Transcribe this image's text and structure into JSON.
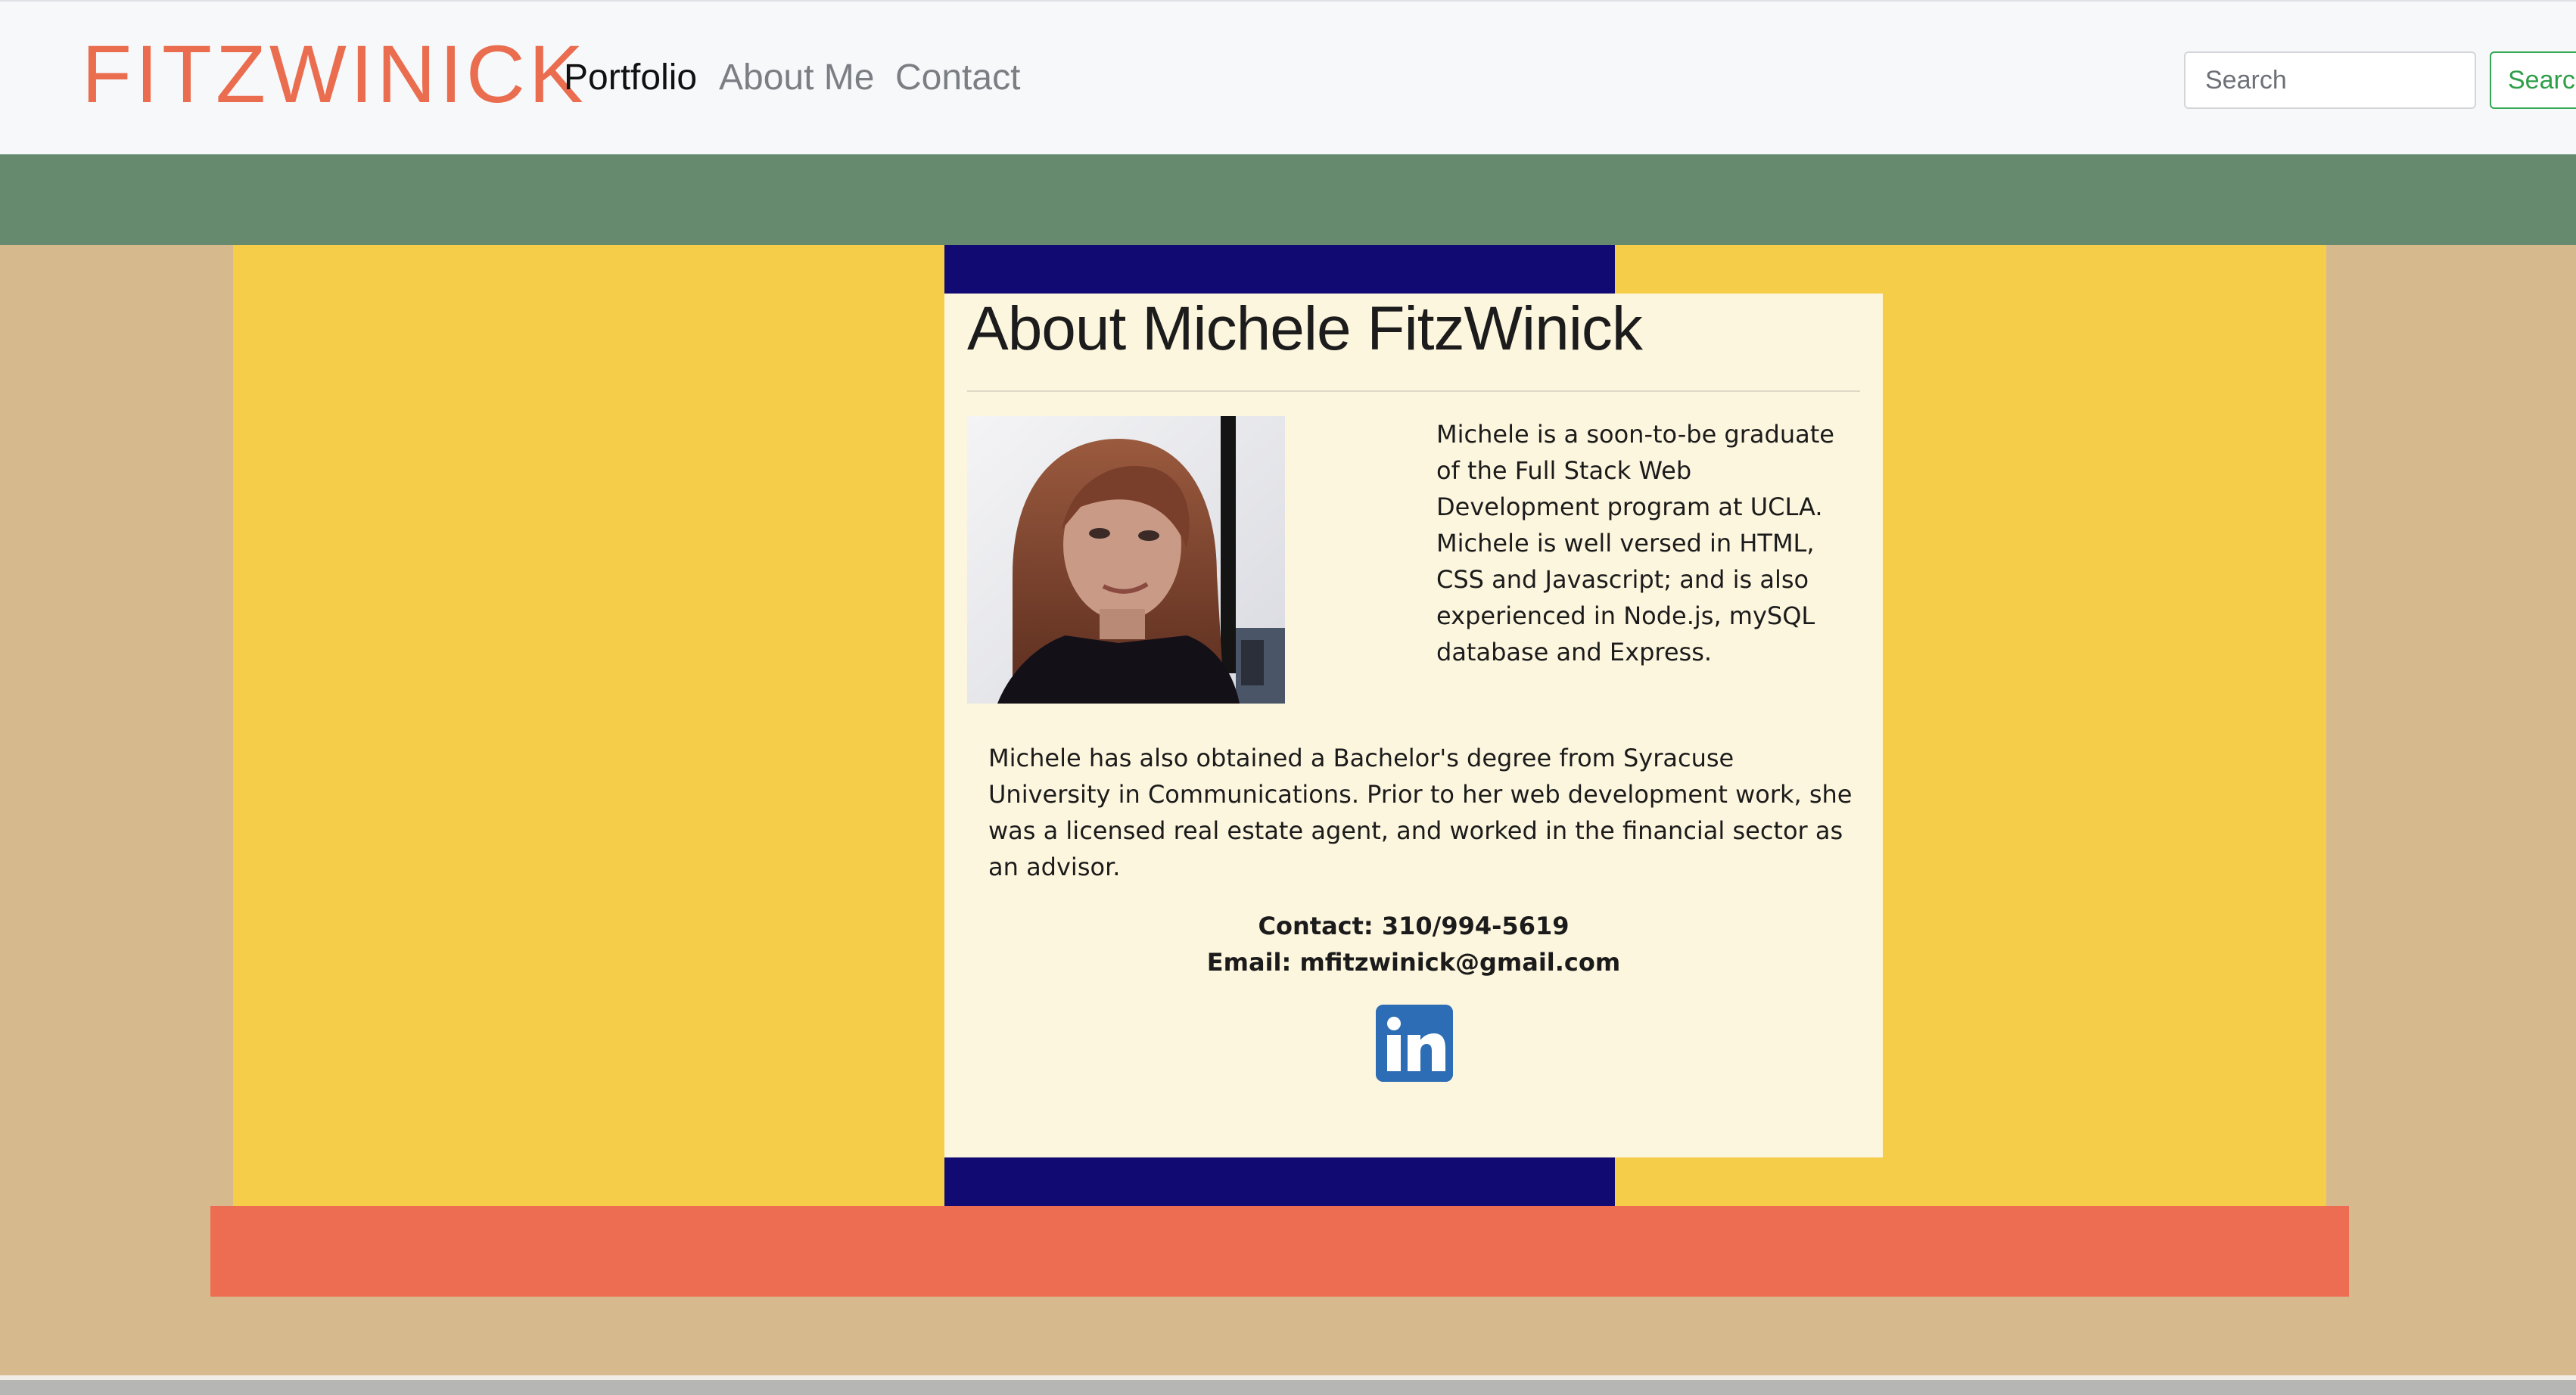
{
  "navbar": {
    "brand": "FITZWINICK",
    "links": [
      {
        "label": "Portfolio",
        "active": true
      },
      {
        "label": "About Me",
        "active": false
      },
      {
        "label": "Contact",
        "active": false
      }
    ],
    "search": {
      "placeholder": "Search",
      "button_label": "Search"
    }
  },
  "card": {
    "title": "About Michele FitzWinick",
    "bio_paragraph_1": "Michele is a soon-to-be graduate of the Full Stack Web Development program at UCLA. Michele is well versed in HTML, CSS and Javascript; and is also experienced in Node.js, mySQL database and Express.",
    "bio_paragraph_2": "Michele has also obtained a Bachelor's degree from Syracuse University in Communications. Prior to her web development work, she was a licensed real estate agent, and worked in the financial sector as an advisor.",
    "contact": "Contact: 310/994-5619",
    "email": "Email: mfitzwinick@gmail.com",
    "social_icon": "linkedin-icon"
  },
  "colors": {
    "navbar_bg": "#f7f8fa",
    "brand": "#ea6d4f",
    "green_band": "#658a6e",
    "tan_bg": "#d7b98e",
    "yellow_panel": "#f6cd49",
    "navy_accent": "#120a73",
    "card_bg": "#fdf6de",
    "coral_band": "#ec6d52",
    "linkedin_blue": "#2d6db5",
    "search_button": "#34a853"
  }
}
